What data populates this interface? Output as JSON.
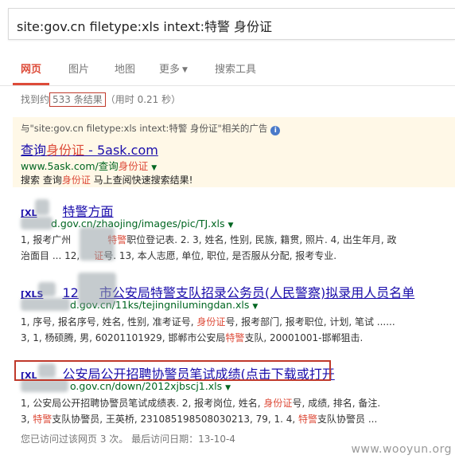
{
  "search": {
    "query": "site:gov.cn filetype:xls intext:特警 身份证"
  },
  "tabs": [
    {
      "label": "网页",
      "active": true
    },
    {
      "label": "图片"
    },
    {
      "label": "地图"
    },
    {
      "label": "更多"
    },
    {
      "label": "搜索工具"
    }
  ],
  "stats": {
    "prefix": "找到约",
    "count": "533 条结果",
    "time": "（用时 0.21 秒）"
  },
  "ad": {
    "header": "与\"site:gov.cn filetype:xls intext:特警 身份证\"相关的广告",
    "title_prefix": "查询",
    "title_hl": "身份证",
    "title_suffix": " - 5ask.com",
    "url_prefix": "www.5ask.com/查询",
    "url_hl": "身份证",
    "desc_prefix": "搜索 查询",
    "desc_hl": "身份证",
    "desc_suffix": " 马上查阅快速搜索结果!"
  },
  "results": [
    {
      "format": "[XL",
      "title": "特警方面",
      "url": "d.gov.cn/zhaojing/images/pic/TJ.xls",
      "line1_a": "1, 报考广州",
      "line1_hl": "特警",
      "line1_b": "职位登记表. 2. 3, 姓名, 性别, 民族, 籍贯, 照片. 4, 出生年月, 政",
      "line2_a": "治面目 ... 12,",
      "line2_hl": "证",
      "line2_b": "号. 13, 本人志愿, 单位, 职位, 是否服从分配, 报考专业."
    },
    {
      "format": "[XLS",
      "title_a": "12",
      "title_b": "市公安局特警支队招录公务员(人民警察)拟录用人员名单",
      "url": "d.gov.cn/11ks/tejingnilumingdan.xls",
      "line1_a": "1, 序号, 报名序号, 姓名, 性别, 准考证号, ",
      "line1_hl": "身份证",
      "line1_b": "号, 报考部门, 报考职位, 计划, 笔试 ......",
      "line2_a": "3, 1, 杨硕腾, 男, 60201101929, 邯郸市公安局",
      "line2_hl": "特警",
      "line2_b": "支队, 20001001-邯郸狙击."
    },
    {
      "format": "[XL",
      "title": "公安局公开招聘协警员笔试成绩(点击下载或打开",
      "url": "o.gov.cn/down/2012xjbscj1.xls",
      "line1_a": "1, 公安局公开招聘协警员笔试成绩表. 2, 报考岗位, 姓名, ",
      "line1_hl": "身份证",
      "line1_b": "号, 成绩, 排名, 备注.",
      "line2_a": "3, ",
      "line2_hl": "特警",
      "line2_b": "支队协警员, 王英桥, 231085198508030213, 79, 1. 4, ",
      "line2_hl2": "特警",
      "line2_c": "支队协警员 ..."
    }
  ],
  "visit": "您已访问过该网页 3 次。 最后访问日期：13-10-4",
  "watermark": "www.wooyun.org"
}
